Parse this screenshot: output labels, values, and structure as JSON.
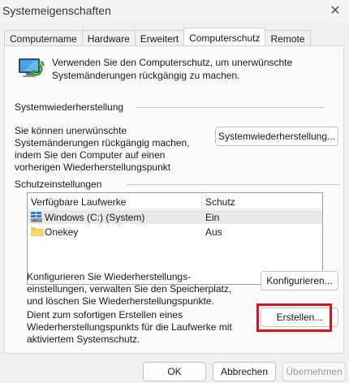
{
  "window": {
    "title": "Systemeigenschaften",
    "close_glyph": "✕"
  },
  "tabs": [
    {
      "label": "Computername"
    },
    {
      "label": "Hardware"
    },
    {
      "label": "Erweitert"
    },
    {
      "label": "Computerschutz",
      "active": true
    },
    {
      "label": "Remote"
    }
  ],
  "intro": {
    "icon": "system-protection-icon",
    "text": "Verwenden Sie den Computerschutz, um unerwünschte Systemänderungen rückgängig zu machen."
  },
  "restore": {
    "group_label": "Systemwiederherstellung",
    "description": "Sie können unerwünschte Systemänderungen rückgängig machen, indem Sie den Computer auf einen vorherigen Wiederherstellungspunkt zurücksetzen.",
    "button_label": "Systemwiederherstellung..."
  },
  "protection": {
    "group_label": "Schutzeinstellungen",
    "columns": [
      "Verfügbare Laufwerke",
      "Schutz"
    ],
    "drives": [
      {
        "name": "Windows (C:) (System)",
        "status": "Ein",
        "icon": "windows-drive-icon",
        "selected": true
      },
      {
        "name": "Onekey",
        "status": "Aus",
        "icon": "folder-icon",
        "selected": false
      }
    ],
    "configure_text": "Konfigurieren Sie Wiederherstellungs-einstellungen, verwalten Sie den Speicherplatz, und löschen Sie Wiederherstellungspunkte.",
    "configure_button": "Konfigurieren...",
    "create_text": "Dient zum sofortigen Erstellen eines Wiederherstellungspunkts für die Laufwerke mit aktiviertem Systemschutz.",
    "create_button": "Erstellen..."
  },
  "footer": {
    "ok_label": "OK",
    "cancel_label": "Abbrechen",
    "apply_label": "Übernehmen"
  },
  "colors": {
    "highlight": "#d9121f",
    "folder": "#f2c94c",
    "drive_blue": "#2b7bd6"
  }
}
